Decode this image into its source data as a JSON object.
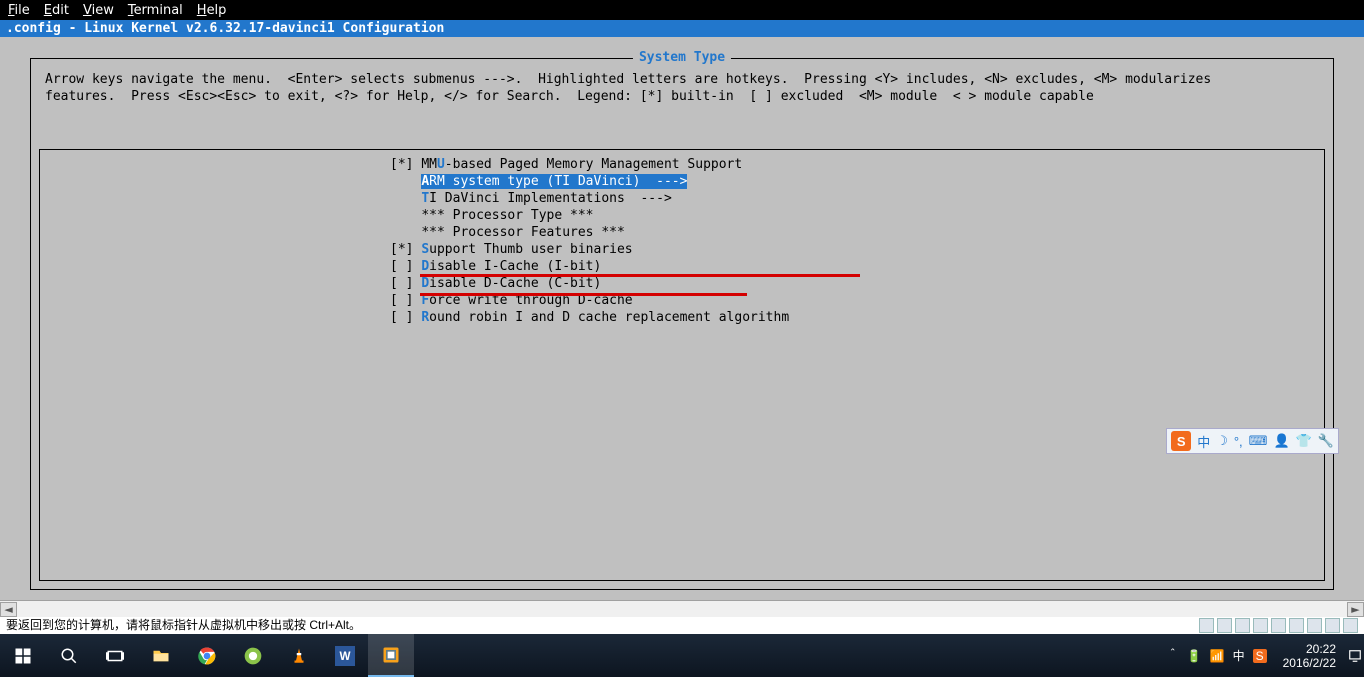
{
  "menubar": {
    "file": "File",
    "edit": "Edit",
    "view": "View",
    "terminal": "Terminal",
    "help": "Help"
  },
  "title_line": " .config - Linux Kernel v2.6.32.17-davinci1 Configuration",
  "box_title": "System Type",
  "help1": "Arrow keys navigate the menu.  <Enter> selects submenus --->.  Highlighted letters are hotkeys.  Pressing <Y> includes, <N> excludes, <M> modularizes",
  "help2": "features.  Press <Esc><Esc> to exit, <?> for Help, </> for Search.  Legend: [*] built-in  [ ] excluded  <M> module  < > module capable",
  "items": [
    {
      "pfx": "[*] ",
      "hot": "",
      "pre": "MM",
      "hotc": "U",
      "txt": "-based Paged Memory Management Support",
      "arrow": "",
      "sel": false
    },
    {
      "pfx": "    ",
      "hot": "",
      "pre": "",
      "hotc": "A",
      "txt": "RM system type (TI DaVinci)  ",
      "arrow": "--->",
      "sel": true
    },
    {
      "pfx": "    ",
      "hot": "",
      "pre": "",
      "hotc": "T",
      "txt": "I DaVinci Implementations  ",
      "arrow": "--->",
      "sel": false
    },
    {
      "pfx": "    ",
      "hot": "",
      "pre": "",
      "hotc": "",
      "txt": "*** Processor Type ***",
      "arrow": "",
      "sel": false
    },
    {
      "pfx": "    ",
      "hot": "",
      "pre": "",
      "hotc": "",
      "txt": "*** Processor Features ***",
      "arrow": "",
      "sel": false
    },
    {
      "pfx": "[*] ",
      "hot": "",
      "pre": "",
      "hotc": "S",
      "txt": "upport Thumb user binaries",
      "arrow": "",
      "sel": false
    },
    {
      "pfx": "[ ] ",
      "hot": "",
      "pre": "",
      "hotc": "D",
      "txt": "isable I-Cache (I-bit)",
      "arrow": "",
      "sel": false
    },
    {
      "pfx": "[ ] ",
      "hot": "",
      "pre": "",
      "hotc": "D",
      "txt": "isable D-Cache (C-bit)",
      "arrow": "",
      "sel": false
    },
    {
      "pfx": "[ ] ",
      "hot": "",
      "pre": "",
      "hotc": "F",
      "txt": "orce write through D-cache",
      "arrow": "",
      "sel": false
    },
    {
      "pfx": "[ ] ",
      "hot": "",
      "pre": "",
      "hotc": "R",
      "txt": "ound robin I and D cache replacement algorithm",
      "arrow": "",
      "sel": false
    }
  ],
  "status_cn": "要返回到您的计算机，请将鼠标指针从虚拟机中移出或按 Ctrl+Alt。",
  "ime": {
    "badge": "S",
    "items": [
      "中",
      "☽",
      "°,",
      "⌨",
      "👤",
      "👕",
      "🔧"
    ]
  },
  "tray": {
    "chevron": "＾",
    "battery": "🔋",
    "wifi": "📶",
    "ime1": "中",
    "ime2": "S"
  },
  "clock": {
    "time": "20:22",
    "date": "2016/2/22"
  },
  "taskbar_apps": [
    "start",
    "search",
    "taskview",
    "explorer",
    "chrome",
    "browser",
    "vlc",
    "wps",
    "vmware"
  ],
  "colors": {
    "accent": "#2277cc",
    "selbg": "#2277cc",
    "red": "#d40000",
    "termbg": "#c0c0c0"
  }
}
